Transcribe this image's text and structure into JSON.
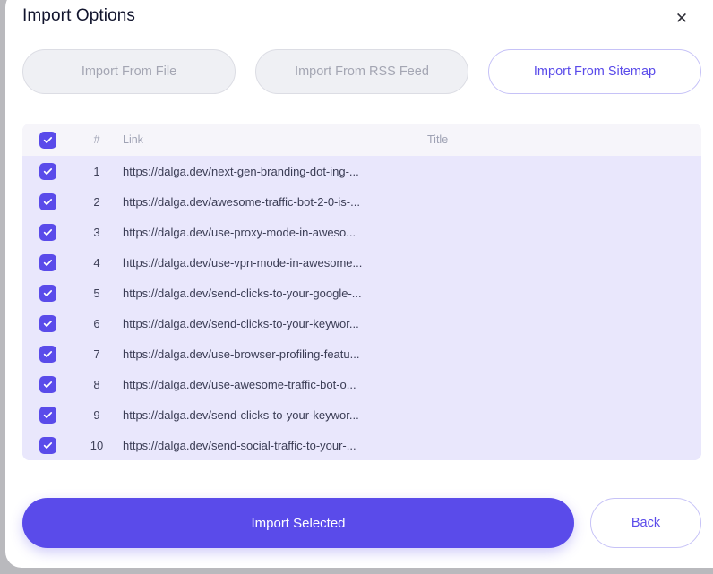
{
  "dialog": {
    "title": "Import Options",
    "close_icon": "close-icon"
  },
  "tabs": [
    {
      "label": "Import From File",
      "active": false
    },
    {
      "label": "Import From RSS Feed",
      "active": false
    },
    {
      "label": "Import From Sitemap",
      "active": true
    }
  ],
  "table": {
    "select_all_checked": true,
    "columns": {
      "check": "",
      "num": "#",
      "link": "Link",
      "title": "Title"
    },
    "rows": [
      {
        "num": "1",
        "checked": true,
        "link": "https://dalga.dev/next-gen-branding-dot-ing-...",
        "title": ""
      },
      {
        "num": "2",
        "checked": true,
        "link": "https://dalga.dev/awesome-traffic-bot-2-0-is-...",
        "title": ""
      },
      {
        "num": "3",
        "checked": true,
        "link": "https://dalga.dev/use-proxy-mode-in-aweso...",
        "title": ""
      },
      {
        "num": "4",
        "checked": true,
        "link": "https://dalga.dev/use-vpn-mode-in-awesome...",
        "title": ""
      },
      {
        "num": "5",
        "checked": true,
        "link": "https://dalga.dev/send-clicks-to-your-google-...",
        "title": ""
      },
      {
        "num": "6",
        "checked": true,
        "link": "https://dalga.dev/send-clicks-to-your-keywor...",
        "title": ""
      },
      {
        "num": "7",
        "checked": true,
        "link": "https://dalga.dev/use-browser-profiling-featu...",
        "title": ""
      },
      {
        "num": "8",
        "checked": true,
        "link": "https://dalga.dev/use-awesome-traffic-bot-o...",
        "title": ""
      },
      {
        "num": "9",
        "checked": true,
        "link": "https://dalga.dev/send-clicks-to-your-keywor...",
        "title": ""
      },
      {
        "num": "10",
        "checked": true,
        "link": "https://dalga.dev/send-social-traffic-to-your-...",
        "title": ""
      }
    ]
  },
  "footer": {
    "import_label": "Import Selected",
    "back_label": "Back"
  },
  "colors": {
    "accent": "#5a4bea",
    "row_background": "#e9e7fc",
    "header_background": "#f6f5fa",
    "tab_disabled_background": "#eff0f4",
    "tab_disabled_text": "#a4a6b3"
  }
}
